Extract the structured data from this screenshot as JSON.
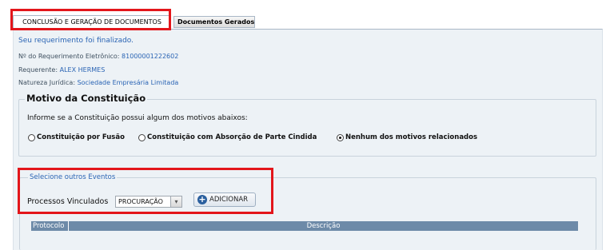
{
  "tabs": {
    "active": "CONCLUSÃO E GERAÇÃO DE DOCUMENTOS",
    "inactive": "Documentos Gerados"
  },
  "status": "Seu requerimento foi finalizado.",
  "info": {
    "req_label": "Nº do Requerimento Eletrônico:",
    "req_value": "81000001222602",
    "requerente_label": "Requerente:",
    "requerente_value": "ALEX HERMES",
    "natureza_label": "Natureza Jurídica:",
    "natureza_value": "Sociedade Empresária Limitada"
  },
  "motivo": {
    "title": "Motivo da Constituição",
    "prompt": "Informe se a Constituição possui algum dos motivos abaixos:",
    "options": [
      {
        "label": "Constituição por Fusão",
        "selected": false
      },
      {
        "label": "Constituição com Absorção de Parte Cindida",
        "selected": false
      },
      {
        "label": "Nenhum dos motivos relacionados",
        "selected": true
      }
    ]
  },
  "eventos": {
    "legend": "Selecione outros Eventos",
    "processos_label": "Processos Vinculados",
    "select_value": "PROCURAÇÃO",
    "add_label": "ADICIONAR"
  },
  "table": {
    "columns": [
      "Protocolo",
      "Descrição"
    ]
  },
  "colors": {
    "highlight": "#e3161b",
    "link": "#2a64b4",
    "table_header": "#6d8aa8"
  }
}
